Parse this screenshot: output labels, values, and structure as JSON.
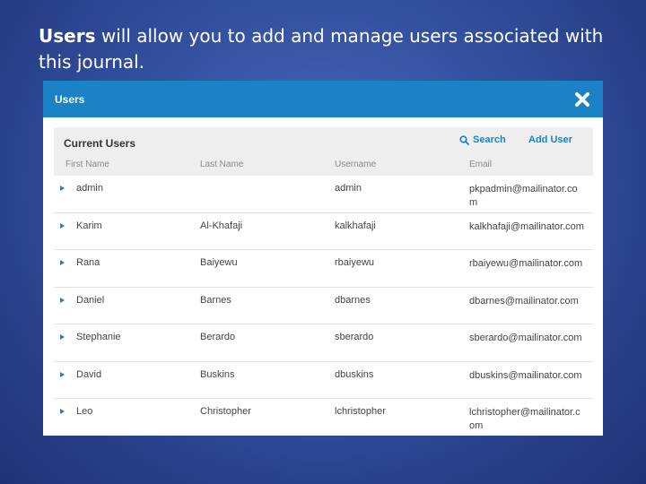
{
  "caption": {
    "bold": "Users",
    "rest": " will allow you to add and manage users associated with this journal."
  },
  "modal": {
    "title": "Users"
  },
  "panel": {
    "title": "Current Users",
    "search_label": "Search",
    "add_user_label": "Add User",
    "columns": [
      "First Name",
      "Last Name",
      "Username",
      "Email"
    ]
  },
  "users": [
    {
      "first": "admin",
      "last": "",
      "username": "admin",
      "email": "pkpadmin@mailinator.com"
    },
    {
      "first": "Karim",
      "last": "Al-Khafaji",
      "username": "kalkhafaji",
      "email": "kalkhafaji@mailinator.com"
    },
    {
      "first": "Rana",
      "last": "Baiyewu",
      "username": "rbaiyewu",
      "email": "rbaiyewu@mailinator.com"
    },
    {
      "first": "Daniel",
      "last": "Barnes",
      "username": "dbarnes",
      "email": "dbarnes@mailinator.com"
    },
    {
      "first": "Stephanie",
      "last": "Berardo",
      "username": "sberardo",
      "email": "sberardo@mailinator.com"
    },
    {
      "first": "David",
      "last": "Buskins",
      "username": "dbuskins",
      "email": "dbuskins@mailinator.com"
    },
    {
      "first": "Leo",
      "last": "Christopher",
      "username": "lchristopher",
      "email": "lchristopher@mailinator.com"
    }
  ],
  "colors": {
    "header": "#1b82c5",
    "link": "#1b82c5",
    "background": "#33509f"
  }
}
